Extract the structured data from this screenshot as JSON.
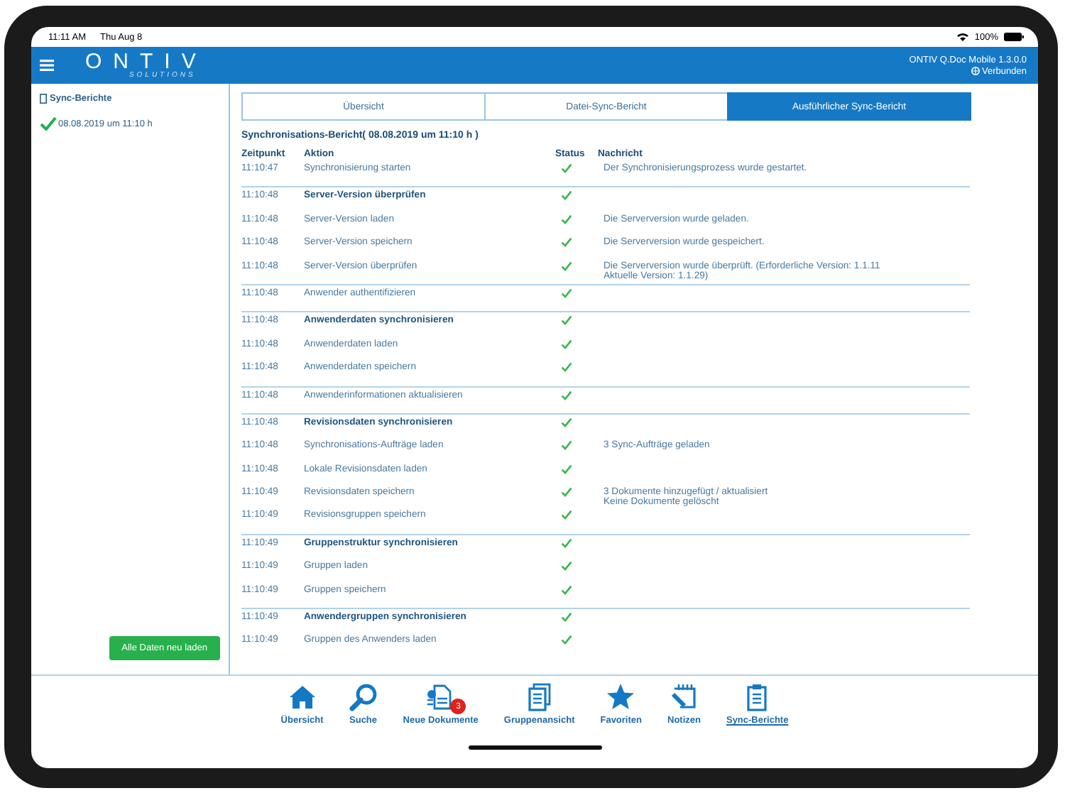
{
  "status_bar": {
    "time": "11:11 AM",
    "date": "Thu Aug 8",
    "battery": "100%"
  },
  "header": {
    "logo": "ONTIV",
    "logo_sub": "SOLUTIONS",
    "app_version": "ONTIV Q.Doc Mobile 1.3.0.0",
    "connection": "Verbunden"
  },
  "sidebar": {
    "title": "Sync-Berichte",
    "items": [
      {
        "label": "08.08.2019 um 11:10 h"
      }
    ],
    "button": "Alle Daten neu laden"
  },
  "tabs": [
    {
      "label": "Übersicht",
      "selected": false
    },
    {
      "label": "Datei-Sync-Bericht",
      "selected": false
    },
    {
      "label": "Ausführlicher Sync-Bericht",
      "selected": true
    }
  ],
  "report": {
    "title": "Synchronisations-Bericht( 08.08.2019 um 11:10 h )",
    "columns": [
      "Zeitpunkt",
      "Aktion",
      "Status",
      "Nachricht"
    ],
    "sections": [
      {
        "rows": [
          {
            "time": "11:10:47",
            "action": "Synchronisierung starten",
            "kind": "step",
            "message": [
              "Der Synchronisierungsprozess wurde gestartet."
            ]
          }
        ]
      },
      {
        "rows": [
          {
            "time": "11:10:48",
            "action": "Server-Version überprüfen",
            "kind": "header",
            "message": []
          },
          {
            "time": "11:10:48",
            "action": "Server-Version laden",
            "kind": "step",
            "message": [
              "Die Serverversion wurde geladen."
            ]
          },
          {
            "time": "11:10:48",
            "action": "Server-Version speichern",
            "kind": "step",
            "message": [
              "Die Serverversion wurde gespeichert."
            ]
          },
          {
            "time": "11:10:48",
            "action": "Server-Version überprüfen",
            "kind": "step",
            "message": [
              "Die Serverversion wurde überprüft. (Erforderliche Version: 1.1.11",
              "Aktuelle Version: 1.1.29)"
            ]
          }
        ]
      },
      {
        "rows": [
          {
            "time": "11:10:48",
            "action": "Anwender authentifizieren",
            "kind": "step",
            "message": []
          }
        ]
      },
      {
        "rows": [
          {
            "time": "11:10:48",
            "action": "Anwenderdaten synchronisieren",
            "kind": "header",
            "message": []
          },
          {
            "time": "11:10:48",
            "action": "Anwenderdaten laden",
            "kind": "step",
            "message": []
          },
          {
            "time": "11:10:48",
            "action": "Anwenderdaten speichern",
            "kind": "step",
            "message": []
          }
        ]
      },
      {
        "rows": [
          {
            "time": "11:10:48",
            "action": "Anwenderinformationen aktualisieren",
            "kind": "step",
            "message": []
          }
        ]
      },
      {
        "rows": [
          {
            "time": "11:10:48",
            "action": "Revisionsdaten synchronisieren",
            "kind": "header",
            "message": []
          },
          {
            "time": "11:10:48",
            "action": "Synchronisations-Aufträge laden",
            "kind": "step",
            "message": [
              "3 Sync-Aufträge geladen"
            ]
          },
          {
            "time": "11:10:48",
            "action": "Lokale Revisionsdaten laden",
            "kind": "step",
            "message": []
          },
          {
            "time": "11:10:49",
            "action": "Revisionsdaten speichern",
            "kind": "step",
            "message": [
              "3 Dokumente hinzugefügt / aktualisiert",
              "Keine Dokumente gelöscht"
            ]
          },
          {
            "time": "11:10:49",
            "action": "Revisionsgruppen speichern",
            "kind": "step",
            "message": []
          }
        ]
      },
      {
        "rows": [
          {
            "time": "11:10:49",
            "action": "Gruppenstruktur synchronisieren",
            "kind": "header",
            "message": []
          },
          {
            "time": "11:10:49",
            "action": "Gruppen laden",
            "kind": "step",
            "message": []
          },
          {
            "time": "11:10:49",
            "action": "Gruppen speichern",
            "kind": "step",
            "message": []
          }
        ]
      },
      {
        "rows": [
          {
            "time": "11:10:49",
            "action": "Anwendergruppen synchronisieren",
            "kind": "header",
            "message": []
          },
          {
            "time": "11:10:49",
            "action": "Gruppen des Anwenders laden",
            "kind": "step",
            "message": []
          }
        ]
      }
    ]
  },
  "nav": [
    {
      "label": "Übersicht",
      "selected": false
    },
    {
      "label": "Suche",
      "selected": false
    },
    {
      "label": "Neue Dokumente",
      "selected": false,
      "badge": "3"
    },
    {
      "label": "Gruppenansicht",
      "selected": false
    },
    {
      "label": "Favoriten",
      "selected": false
    },
    {
      "label": "Notizen",
      "selected": false
    },
    {
      "label": "Sync-Berichte",
      "selected": true
    }
  ]
}
